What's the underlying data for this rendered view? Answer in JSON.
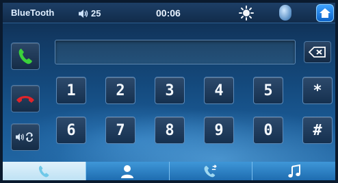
{
  "status": {
    "title": "BlueTooth",
    "volume": "25",
    "time": "00:06"
  },
  "display": {
    "number": ""
  },
  "keypad": {
    "row1": [
      "1",
      "2",
      "3",
      "4",
      "5",
      "*"
    ],
    "row2": [
      "6",
      "7",
      "8",
      "9",
      "0",
      "#"
    ]
  },
  "tabs": [
    "phone",
    "contacts",
    "recent-calls",
    "music"
  ],
  "active_tab": "phone",
  "colors": {
    "accept": "#3bd23b",
    "reject": "#e0242a",
    "tab_active": "#d0ebf8",
    "tab": "#2b7dc2"
  }
}
